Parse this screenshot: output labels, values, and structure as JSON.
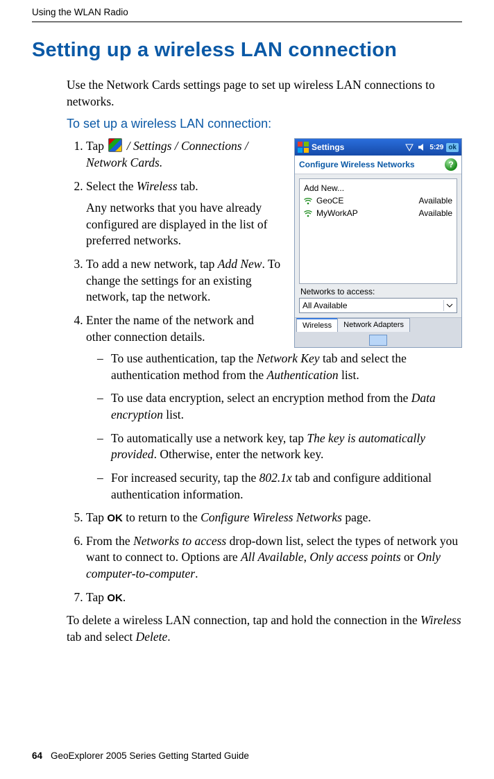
{
  "running_head": "Using the WLAN Radio",
  "section_title": "Setting up a wireless LAN connection",
  "intro": "Use the Network Cards settings page to set up wireless LAN connections to networks.",
  "subhead": "To set up a wireless LAN connection:",
  "steps": {
    "s1_a": "Tap ",
    "s1_b": " / Settings / Connections / Network Cards.",
    "s2": "Select the Wireless tab.",
    "s2_note": "Any networks that you have already configured are displayed in the list of preferred networks.",
    "s3": "To add a new network, tap Add New. To change the settings for an existing network, tap the network.",
    "s4": " Enter the name of the network and other connection details.",
    "s4_d1": "To use authentication, tap the Network Key tab and select the authentication method from the Authentication list.",
    "s4_d2": "To use data encryption, select an encryption method from the Data encryption list.",
    "s4_d3": "To automatically use a network key, tap The key is automatically provided. Otherwise, enter the network key.",
    "s4_d4": "For increased security, tap the 802.1x tab and configure additional authentication information.",
    "s5_a": "Tap ",
    "s5_ok": "OK",
    "s5_b": " to return to the Configure Wireless Networks page.",
    "s6": "From the Networks to access drop-down list, select the types of network you want to connect to. Options are All Available, Only access points or Only computer-to-computer.",
    "s7_a": "Tap ",
    "s7_ok": "OK",
    "s7_b": "."
  },
  "trail": "To delete a wireless LAN connection, tap and hold the connection in the Wireless tab and select Delete.",
  "footer": {
    "page": "64",
    "title": "GeoExplorer 2005 Series Getting Started Guide"
  },
  "device": {
    "title": "Settings",
    "time": "5:29",
    "ok": "ok",
    "subtitle": "Configure Wireless Networks",
    "list": {
      "addnew": "Add New...",
      "rows": [
        {
          "name": "GeoCE",
          "status": "Available"
        },
        {
          "name": "MyWorkAP",
          "status": "Available"
        }
      ]
    },
    "access_label": "Networks to access:",
    "dropdown_value": "All Available",
    "tabs": {
      "wireless": "Wireless",
      "adapters": "Network Adapters"
    }
  }
}
